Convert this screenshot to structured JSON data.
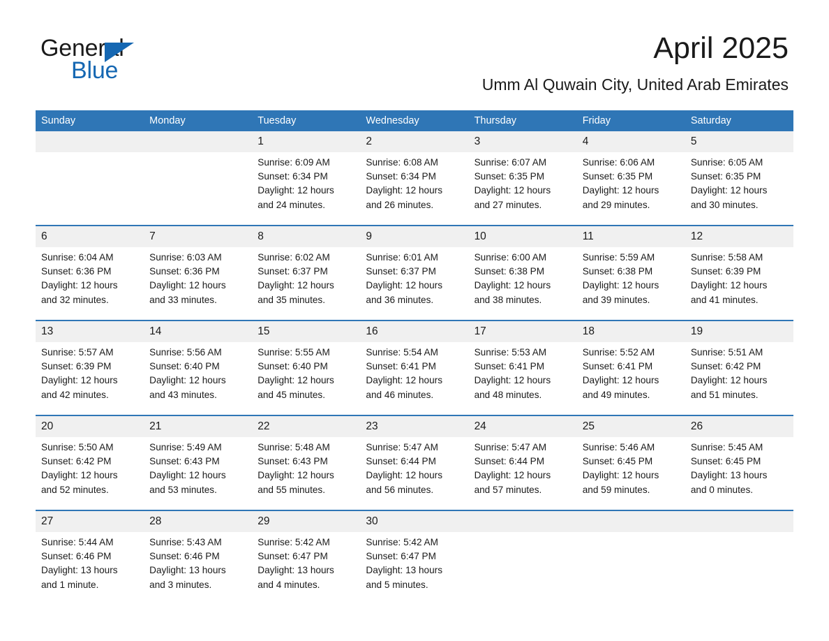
{
  "brand": {
    "name_part1": "General",
    "name_part2": "Blue",
    "logo_triangle_color": "#1567b2",
    "accent_color": "#2f76b6"
  },
  "header": {
    "title": "April 2025",
    "location": "Umm Al Quwain City, United Arab Emirates"
  },
  "calendar": {
    "weekdays": [
      "Sunday",
      "Monday",
      "Tuesday",
      "Wednesday",
      "Thursday",
      "Friday",
      "Saturday"
    ],
    "header_bg": "#2f76b6",
    "daynum_bg": "#f0f0f0",
    "weeks": [
      {
        "days": [
          {
            "num": "",
            "lines": []
          },
          {
            "num": "",
            "lines": []
          },
          {
            "num": "1",
            "lines": [
              "Sunrise: 6:09 AM",
              "Sunset: 6:34 PM",
              "Daylight: 12 hours",
              "and 24 minutes."
            ]
          },
          {
            "num": "2",
            "lines": [
              "Sunrise: 6:08 AM",
              "Sunset: 6:34 PM",
              "Daylight: 12 hours",
              "and 26 minutes."
            ]
          },
          {
            "num": "3",
            "lines": [
              "Sunrise: 6:07 AM",
              "Sunset: 6:35 PM",
              "Daylight: 12 hours",
              "and 27 minutes."
            ]
          },
          {
            "num": "4",
            "lines": [
              "Sunrise: 6:06 AM",
              "Sunset: 6:35 PM",
              "Daylight: 12 hours",
              "and 29 minutes."
            ]
          },
          {
            "num": "5",
            "lines": [
              "Sunrise: 6:05 AM",
              "Sunset: 6:35 PM",
              "Daylight: 12 hours",
              "and 30 minutes."
            ]
          }
        ]
      },
      {
        "days": [
          {
            "num": "6",
            "lines": [
              "Sunrise: 6:04 AM",
              "Sunset: 6:36 PM",
              "Daylight: 12 hours",
              "and 32 minutes."
            ]
          },
          {
            "num": "7",
            "lines": [
              "Sunrise: 6:03 AM",
              "Sunset: 6:36 PM",
              "Daylight: 12 hours",
              "and 33 minutes."
            ]
          },
          {
            "num": "8",
            "lines": [
              "Sunrise: 6:02 AM",
              "Sunset: 6:37 PM",
              "Daylight: 12 hours",
              "and 35 minutes."
            ]
          },
          {
            "num": "9",
            "lines": [
              "Sunrise: 6:01 AM",
              "Sunset: 6:37 PM",
              "Daylight: 12 hours",
              "and 36 minutes."
            ]
          },
          {
            "num": "10",
            "lines": [
              "Sunrise: 6:00 AM",
              "Sunset: 6:38 PM",
              "Daylight: 12 hours",
              "and 38 minutes."
            ]
          },
          {
            "num": "11",
            "lines": [
              "Sunrise: 5:59 AM",
              "Sunset: 6:38 PM",
              "Daylight: 12 hours",
              "and 39 minutes."
            ]
          },
          {
            "num": "12",
            "lines": [
              "Sunrise: 5:58 AM",
              "Sunset: 6:39 PM",
              "Daylight: 12 hours",
              "and 41 minutes."
            ]
          }
        ]
      },
      {
        "days": [
          {
            "num": "13",
            "lines": [
              "Sunrise: 5:57 AM",
              "Sunset: 6:39 PM",
              "Daylight: 12 hours",
              "and 42 minutes."
            ]
          },
          {
            "num": "14",
            "lines": [
              "Sunrise: 5:56 AM",
              "Sunset: 6:40 PM",
              "Daylight: 12 hours",
              "and 43 minutes."
            ]
          },
          {
            "num": "15",
            "lines": [
              "Sunrise: 5:55 AM",
              "Sunset: 6:40 PM",
              "Daylight: 12 hours",
              "and 45 minutes."
            ]
          },
          {
            "num": "16",
            "lines": [
              "Sunrise: 5:54 AM",
              "Sunset: 6:41 PM",
              "Daylight: 12 hours",
              "and 46 minutes."
            ]
          },
          {
            "num": "17",
            "lines": [
              "Sunrise: 5:53 AM",
              "Sunset: 6:41 PM",
              "Daylight: 12 hours",
              "and 48 minutes."
            ]
          },
          {
            "num": "18",
            "lines": [
              "Sunrise: 5:52 AM",
              "Sunset: 6:41 PM",
              "Daylight: 12 hours",
              "and 49 minutes."
            ]
          },
          {
            "num": "19",
            "lines": [
              "Sunrise: 5:51 AM",
              "Sunset: 6:42 PM",
              "Daylight: 12 hours",
              "and 51 minutes."
            ]
          }
        ]
      },
      {
        "days": [
          {
            "num": "20",
            "lines": [
              "Sunrise: 5:50 AM",
              "Sunset: 6:42 PM",
              "Daylight: 12 hours",
              "and 52 minutes."
            ]
          },
          {
            "num": "21",
            "lines": [
              "Sunrise: 5:49 AM",
              "Sunset: 6:43 PM",
              "Daylight: 12 hours",
              "and 53 minutes."
            ]
          },
          {
            "num": "22",
            "lines": [
              "Sunrise: 5:48 AM",
              "Sunset: 6:43 PM",
              "Daylight: 12 hours",
              "and 55 minutes."
            ]
          },
          {
            "num": "23",
            "lines": [
              "Sunrise: 5:47 AM",
              "Sunset: 6:44 PM",
              "Daylight: 12 hours",
              "and 56 minutes."
            ]
          },
          {
            "num": "24",
            "lines": [
              "Sunrise: 5:47 AM",
              "Sunset: 6:44 PM",
              "Daylight: 12 hours",
              "and 57 minutes."
            ]
          },
          {
            "num": "25",
            "lines": [
              "Sunrise: 5:46 AM",
              "Sunset: 6:45 PM",
              "Daylight: 12 hours",
              "and 59 minutes."
            ]
          },
          {
            "num": "26",
            "lines": [
              "Sunrise: 5:45 AM",
              "Sunset: 6:45 PM",
              "Daylight: 13 hours",
              "and 0 minutes."
            ]
          }
        ]
      },
      {
        "days": [
          {
            "num": "27",
            "lines": [
              "Sunrise: 5:44 AM",
              "Sunset: 6:46 PM",
              "Daylight: 13 hours",
              "and 1 minute."
            ]
          },
          {
            "num": "28",
            "lines": [
              "Sunrise: 5:43 AM",
              "Sunset: 6:46 PM",
              "Daylight: 13 hours",
              "and 3 minutes."
            ]
          },
          {
            "num": "29",
            "lines": [
              "Sunrise: 5:42 AM",
              "Sunset: 6:47 PM",
              "Daylight: 13 hours",
              "and 4 minutes."
            ]
          },
          {
            "num": "30",
            "lines": [
              "Sunrise: 5:42 AM",
              "Sunset: 6:47 PM",
              "Daylight: 13 hours",
              "and 5 minutes."
            ]
          },
          {
            "num": "",
            "lines": []
          },
          {
            "num": "",
            "lines": []
          },
          {
            "num": "",
            "lines": []
          }
        ]
      }
    ]
  }
}
